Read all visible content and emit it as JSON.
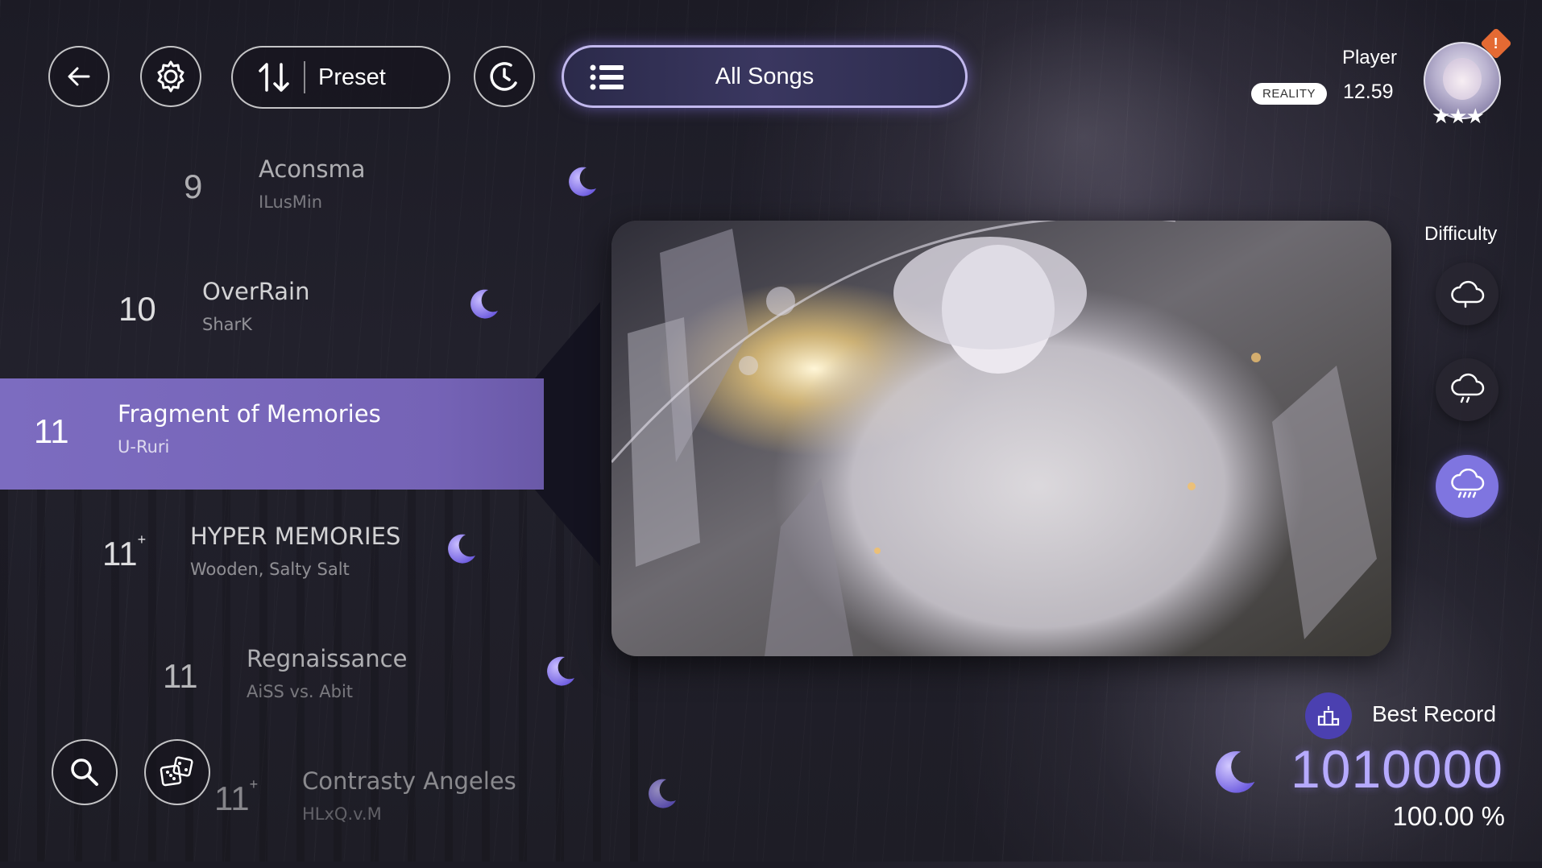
{
  "topbar": {
    "sort_label": "Preset",
    "category_label": "All Songs"
  },
  "player": {
    "name": "Player",
    "badge": "REALITY",
    "rks": "12.59",
    "notice": "!"
  },
  "songs": [
    {
      "level": "9",
      "plus": "",
      "title": "Aconsma",
      "composer": "ILusMin"
    },
    {
      "level": "10",
      "plus": "",
      "title": "OverRain",
      "composer": "SharK"
    },
    {
      "level": "11",
      "plus": "",
      "title": "Fragment of Memories",
      "composer": "U-Ruri"
    },
    {
      "level": "11",
      "plus": "+",
      "title": "HYPER MEMORIES",
      "composer": "Wooden, Salty Salt"
    },
    {
      "level": "11",
      "plus": "",
      "title": "Regnaissance",
      "composer": "AiSS vs. Abit"
    },
    {
      "level": "11",
      "plus": "+",
      "title": "Contrasty Angeles",
      "composer": "HLxQ.v.M"
    }
  ],
  "difficulty": {
    "label": "Difficulty",
    "levels": [
      {
        "icon": "cloud-icon",
        "selected": false
      },
      {
        "icon": "cloud-drizzle-icon",
        "selected": false
      },
      {
        "icon": "cloud-rain-icon",
        "selected": true
      }
    ]
  },
  "record": {
    "label": "Best Record",
    "score": "1010000",
    "accuracy": "100.00 %"
  },
  "colors": {
    "accent": "#7c6cc0",
    "score": "#b6aaff",
    "moon": "#8f7ef0"
  }
}
